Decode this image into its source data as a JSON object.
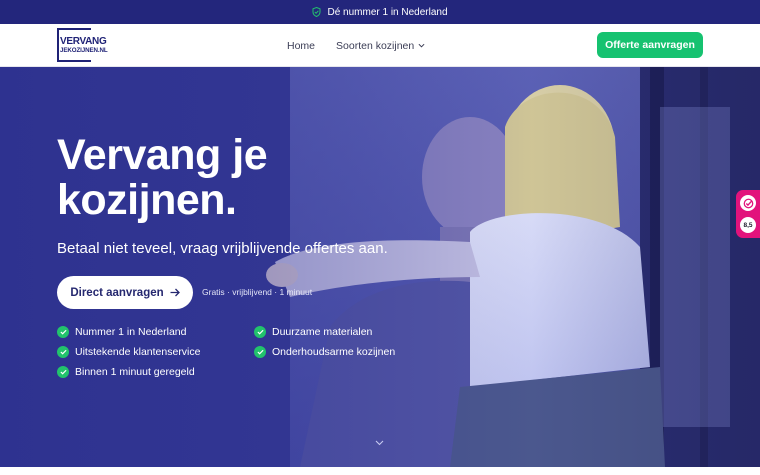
{
  "topbar": {
    "text": "Dé nummer 1 in Nederland",
    "icon": "shield-check-icon"
  },
  "brand": {
    "logo_line1": "VERVANG",
    "logo_line2": "JEKOZIJNEN.NL",
    "color": "#1f2276"
  },
  "nav": {
    "items": [
      {
        "label": "Home"
      },
      {
        "label": "Soorten kozijnen",
        "icon": "chevron-down-icon"
      }
    ],
    "cta_label": "Offerte aanvragen"
  },
  "hero": {
    "title": "Vervang je kozijnen.",
    "subtitle": "Betaal niet teveel, vraag vrijblijvende offertes aan.",
    "button_label": "Direct aanvragen",
    "button_icon": "arrow-right-icon",
    "note": "Gratis · vrijblijvend · 1 minuut",
    "features": [
      "Nummer 1 in Nederland",
      "Uitstekende klantenservice",
      "Binnen 1 minuut geregeld",
      "Duurzame materialen",
      "Onderhoudsarme kozijnen"
    ]
  },
  "review_badge": {
    "score": "8,5",
    "color": "#e2137c"
  },
  "colors": {
    "topbar": "#23267c",
    "cta": "#16c270",
    "check": "#22c36c",
    "hero": "#3b3f9c"
  }
}
